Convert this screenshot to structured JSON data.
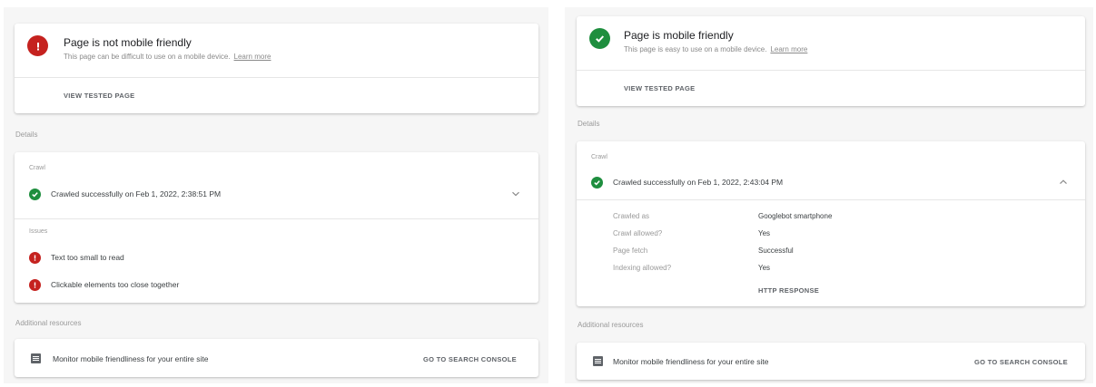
{
  "left": {
    "status_title": "Page is not mobile friendly",
    "status_subtitle": "This page can be difficult to use on a mobile device.",
    "learn_more": "Learn more",
    "view_tested_page": "VIEW TESTED PAGE",
    "details_label": "Details",
    "crawl_label": "Crawl",
    "crawl_status": "Crawled successfully on Feb 1, 2022, 2:38:51 PM",
    "issues_label": "Issues",
    "issues": [
      "Text too small to read",
      "Clickable elements too close together"
    ],
    "additional_resources_label": "Additional resources",
    "resource_text": "Monitor mobile friendliness for your entire site",
    "resource_button": "GO TO SEARCH CONSOLE"
  },
  "right": {
    "status_title": "Page is mobile friendly",
    "status_subtitle": "This page is easy to use on a mobile device.",
    "learn_more": "Learn more",
    "view_tested_page": "VIEW TESTED PAGE",
    "details_label": "Details",
    "crawl_label": "Crawl",
    "crawl_status": "Crawled successfully on Feb 1, 2022, 2:43:04 PM",
    "crawl_details": [
      {
        "key": "Crawled as",
        "value": "Googlebot smartphone"
      },
      {
        "key": "Crawl allowed?",
        "value": "Yes"
      },
      {
        "key": "Page fetch",
        "value": "Successful"
      },
      {
        "key": "Indexing allowed?",
        "value": "Yes"
      }
    ],
    "http_response": "HTTP RESPONSE",
    "additional_resources_label": "Additional resources",
    "resource_text": "Monitor mobile friendliness for your entire site",
    "resource_button": "GO TO SEARCH CONSOLE"
  },
  "colors": {
    "error": "#c5221f",
    "success": "#1e8e3e"
  }
}
